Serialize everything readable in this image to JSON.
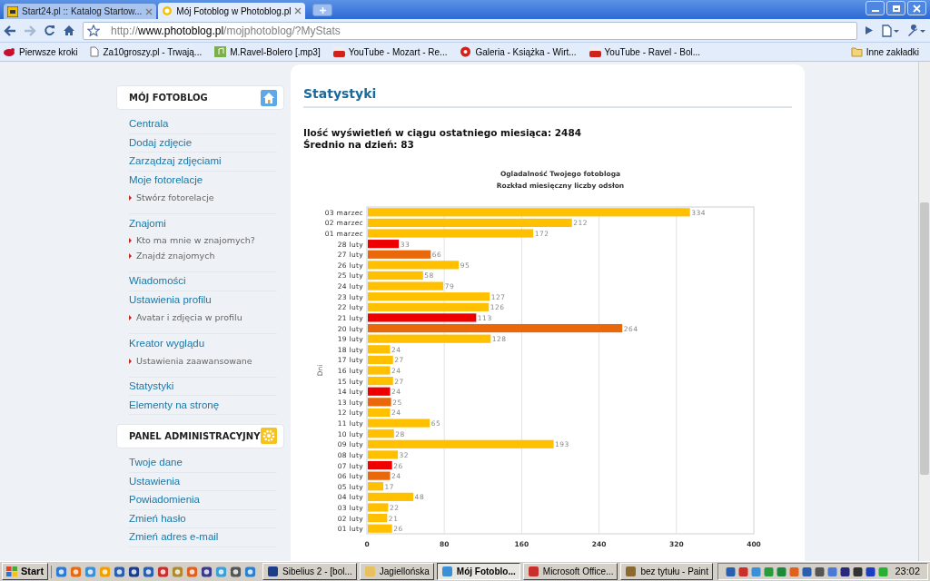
{
  "tabs": [
    {
      "label": "Start24.pl :: Katalog Startow...",
      "selected": false
    },
    {
      "label": "Mój Fotoblog w Photoblog.pl",
      "selected": true
    }
  ],
  "address": {
    "scheme": "http://",
    "host": "www.photoblog.pl",
    "path": "/mojphotoblog/?MyStats"
  },
  "bookmarks": [
    {
      "label": "Pierwsze kroki"
    },
    {
      "label": "Za10groszy.pl - Trwają..."
    },
    {
      "label": "M.Ravel-Bolero [.mp3]"
    },
    {
      "label": "YouTube - Mozart - Re..."
    },
    {
      "label": "Galeria - Książka - Wirt..."
    },
    {
      "label": "YouTube - Ravel - Bol..."
    }
  ],
  "other_bookmarks": "Inne zakładki",
  "sidebar": [
    {
      "title": "MÓJ FOTOBLOG",
      "items": [
        {
          "kind": "link",
          "label": "Centrala"
        },
        {
          "kind": "link",
          "label": "Dodaj zdjęcie"
        },
        {
          "kind": "link",
          "label": "Zarządzaj zdjęciami"
        },
        {
          "kind": "link",
          "label": "Moje fotorelacje"
        },
        {
          "kind": "sub",
          "label": "Stwórz fotorelacje"
        },
        {
          "kind": "link",
          "label": "Znajomi"
        },
        {
          "kind": "sub",
          "label": "Kto ma mnie w znajomych?"
        },
        {
          "kind": "sub",
          "label": "Znajdź znajomych"
        },
        {
          "kind": "link",
          "label": "Wiadomości"
        },
        {
          "kind": "link",
          "label": "Ustawienia profilu"
        },
        {
          "kind": "sub",
          "label": "Avatar i zdjęcia w profilu"
        },
        {
          "kind": "link",
          "label": "Kreator wyglądu"
        },
        {
          "kind": "sub",
          "label": "Ustawienia zaawansowane"
        },
        {
          "kind": "link",
          "label": "Statystyki"
        },
        {
          "kind": "link",
          "label": "Elementy na stronę"
        }
      ]
    },
    {
      "title": "PANEL ADMINISTRACYJNY",
      "items": [
        {
          "kind": "link",
          "label": "Twoje dane"
        },
        {
          "kind": "link",
          "label": "Ustawienia"
        },
        {
          "kind": "link",
          "label": "Powiadomienia"
        },
        {
          "kind": "link",
          "label": "Zmień hasło"
        },
        {
          "kind": "link",
          "label": "Zmień adres e-mail"
        }
      ]
    }
  ],
  "main": {
    "heading": "Statystyki",
    "stats": [
      "Ilość wyświetleń w ciągu ostatniego miesiąca: 2484",
      "Średnio na dzień: 83"
    ],
    "chart_data": {
      "type": "bar",
      "orientation": "horizontal",
      "title": "Ogladalność Twojego fotobloga\nRozkład miesięczny liczby odsłon",
      "ylabel": "Dni",
      "categories": [
        "03 marzec",
        "02 marzec",
        "01 marzec",
        "28 luty",
        "27 luty",
        "26 luty",
        "25 luty",
        "24 luty",
        "23 luty",
        "22 luty",
        "21 luty",
        "20 luty",
        "19 luty",
        "18 luty",
        "17 luty",
        "16 luty",
        "15 luty",
        "14 luty",
        "13 luty",
        "12 luty",
        "11 luty",
        "10 luty",
        "09 luty",
        "08 luty",
        "07 luty",
        "06 luty",
        "05 luty",
        "04 luty",
        "03 luty",
        "02 luty",
        "01 luty"
      ],
      "series": [
        {
          "color": "#ffc000",
          "values": [
            334,
            212,
            172,
            null,
            null,
            95,
            58,
            79,
            127,
            126,
            null,
            null,
            128,
            24,
            27,
            24,
            27,
            null,
            null,
            24,
            65,
            28,
            193,
            32,
            null,
            null,
            17,
            48,
            22,
            21,
            26
          ]
        },
        {
          "color": "#e8680a",
          "values": [
            null,
            null,
            null,
            null,
            66,
            null,
            null,
            null,
            null,
            null,
            null,
            264,
            null,
            null,
            null,
            null,
            null,
            null,
            25,
            null,
            null,
            null,
            null,
            null,
            null,
            24,
            null,
            null,
            null,
            null,
            null
          ]
        },
        {
          "color": "#ee0000",
          "values": [
            null,
            null,
            null,
            33,
            null,
            null,
            null,
            null,
            null,
            null,
            113,
            null,
            null,
            null,
            null,
            null,
            null,
            24,
            null,
            null,
            null,
            null,
            null,
            null,
            26,
            null,
            null,
            null,
            null,
            null,
            null
          ]
        }
      ],
      "xlim": [
        0,
        400
      ],
      "xticks": [
        0,
        80,
        160,
        240,
        320,
        400
      ],
      "grid": true,
      "data_labels": true
    }
  },
  "taskbar": {
    "start": "Start",
    "tasks": [
      {
        "label": "Sibelius 2 - [bol...",
        "selected": false
      },
      {
        "label": "Jagiellońska",
        "selected": false
      },
      {
        "label": "Mój Fotoblo...",
        "selected": true
      },
      {
        "label": "Microsoft Office...",
        "selected": false
      },
      {
        "label": "bez tytułu - Paint",
        "selected": false
      }
    ],
    "clock": "23:02"
  }
}
